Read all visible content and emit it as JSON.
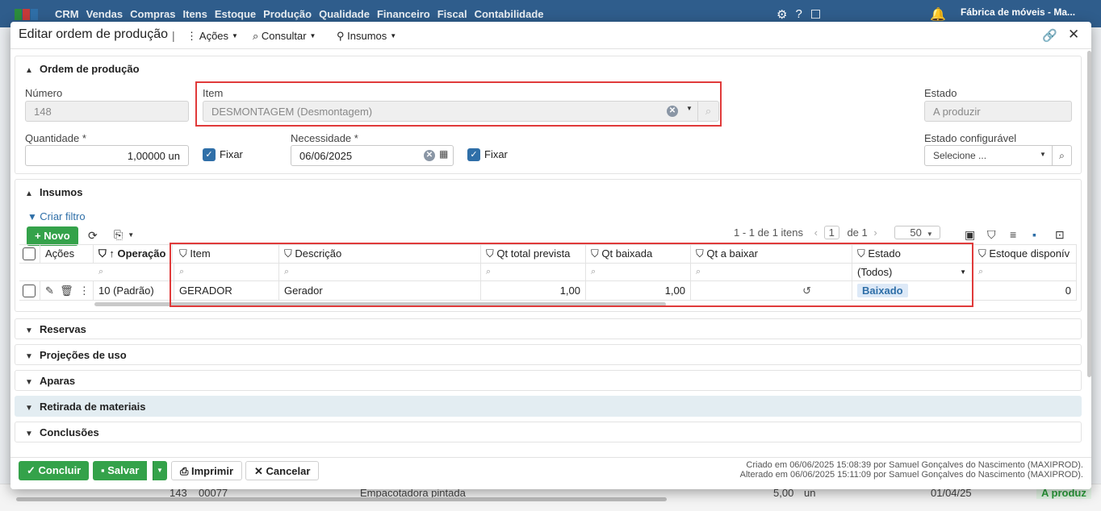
{
  "topnav": {
    "menus": [
      "CRM",
      "Vendas",
      "Compras",
      "Itens",
      "Estoque",
      "Produção",
      "Qualidade",
      "Financeiro",
      "Fiscal",
      "Contabilidade"
    ],
    "company": "Fábrica de móveis - Ma..."
  },
  "background_row": {
    "number": "143",
    "code": "00077",
    "description": "Empacotadora pintada",
    "qty": "5,00",
    "unit": "un",
    "date": "01/04/25",
    "status": "A produz"
  },
  "modal": {
    "title": "Editar ordem de produção",
    "separator": "|",
    "actions_label": "Ações",
    "consult_label": "Consultar",
    "inputs_label": "Insumos"
  },
  "order": {
    "section_title": "Ordem de produção",
    "number_label": "Número",
    "number_value": "148",
    "item_label": "Item",
    "item_value": "DESMONTAGEM (Desmontagem)",
    "state_label": "Estado",
    "state_value": "A produzir",
    "quantity_label": "Quantidade *",
    "quantity_value": "1,00000 un",
    "fix_label": "Fixar",
    "need_label": "Necessidade *",
    "need_value": "06/06/2025",
    "config_state_label": "Estado configurável",
    "config_state_placeholder": "Selecione ..."
  },
  "insumos": {
    "section_title": "Insumos",
    "create_filter": "Criar filtro",
    "new_button": "Novo",
    "pager_text": "1 - 1 de 1 itens",
    "page": "1",
    "of_label": "de",
    "pages": "1",
    "page_size": "50",
    "columns": [
      "Ações",
      "Operação",
      "Item",
      "Descrição",
      "Qt total prevista",
      "Qt baixada",
      "Qt a baixar",
      "Estado",
      "Estoque disponív"
    ],
    "estado_filter": "(Todos)",
    "row": {
      "operation": "10 (Padrão)",
      "item": "GERADOR",
      "description": "Gerador",
      "qt_prevista": "1,00",
      "qt_baixada": "1,00",
      "estado": "Baixado",
      "estoque": "0"
    }
  },
  "sections": [
    "Reservas",
    "Projeções de uso",
    "Aparas",
    "Retirada de materiais",
    "Conclusões"
  ],
  "footer": {
    "conclude": "Concluir",
    "save": "Salvar",
    "print": "Imprimir",
    "cancel": "Cancelar",
    "created": "Criado em 06/06/2025 15:08:39 por Samuel Gonçalves do Nascimento (MAXIPROD).",
    "modified": "Alterado em 06/06/2025 15:11:09 por Samuel Gonçalves do Nascimento (MAXIPROD)."
  }
}
